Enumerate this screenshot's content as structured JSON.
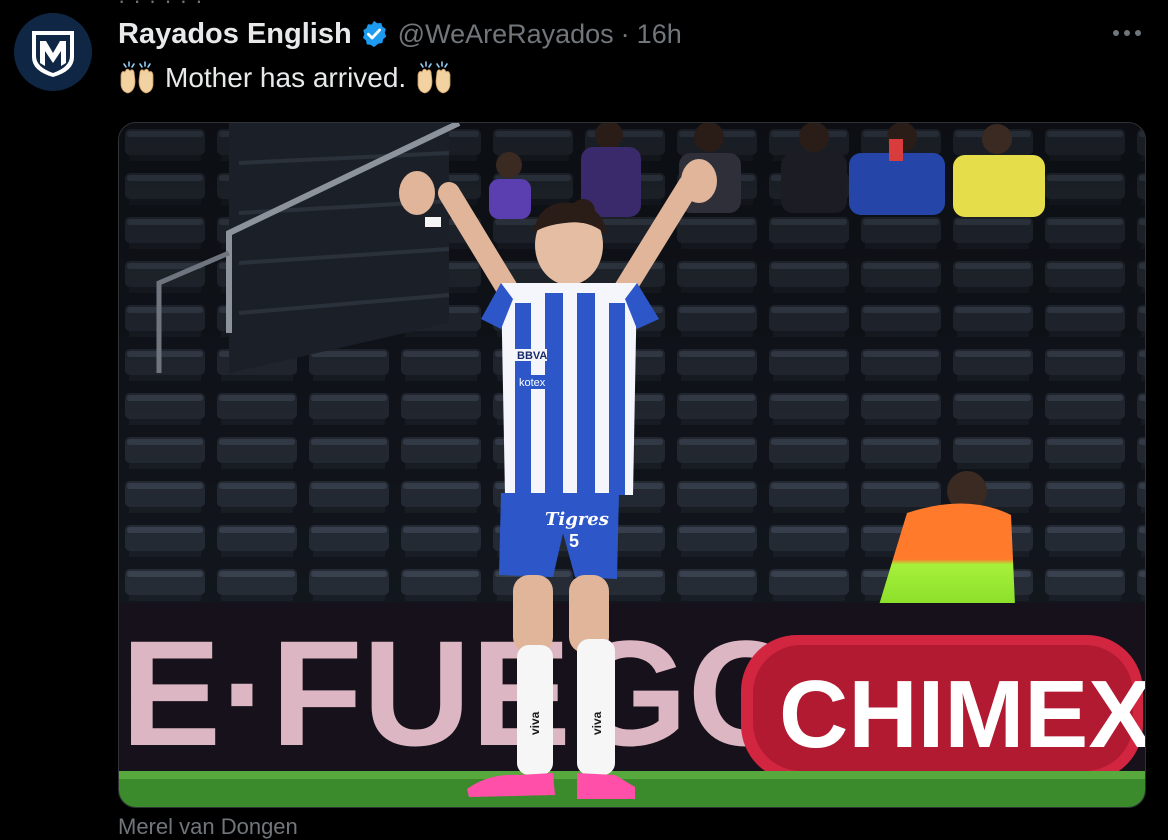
{
  "tweet": {
    "display_name": "Rayados English",
    "handle": "@WeAreRayados",
    "separator": "·",
    "time": "16h",
    "text": "Mother has arrived.",
    "emoji": "raising-hands-emoji",
    "verified": true
  },
  "media": {
    "banner_left_text": "E·FUEGO",
    "banner_right_text": "CHIMEX",
    "shirt_sponsor_1": "BBVA",
    "shirt_sponsor_2": "kotex",
    "shorts_sponsor": "Tigres",
    "shorts_number": "5",
    "sock_brand": "viva"
  },
  "partial_caption": "Merel van Dongen",
  "colors": {
    "background": "#000000",
    "text_primary": "#e7e9ea",
    "text_secondary": "#71767b",
    "verified_badge": "#1d9bf0"
  },
  "icons": {
    "avatar": "rayados-logo-icon",
    "verified": "verified-badge-icon",
    "more": "more-options-icon"
  }
}
